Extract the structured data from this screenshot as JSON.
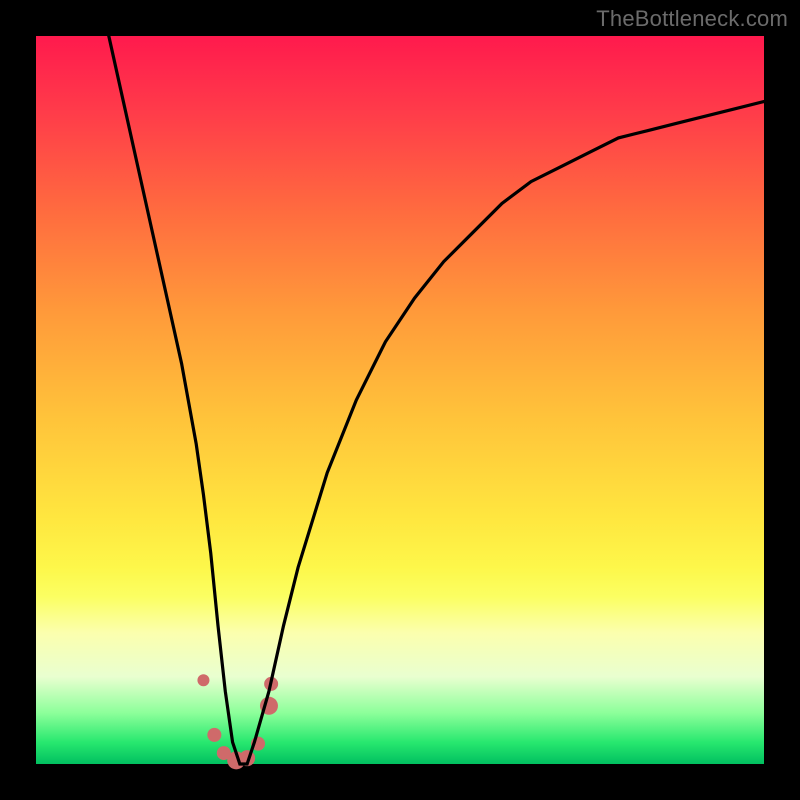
{
  "watermark": "TheBottleneck.com",
  "chart_data": {
    "type": "line",
    "title": "",
    "xlabel": "",
    "ylabel": "",
    "xlim": [
      0,
      100
    ],
    "ylim": [
      0,
      100
    ],
    "grid": false,
    "legend": false,
    "curve": {
      "name": "bottleneck-curve",
      "color": "#000000",
      "x": [
        10,
        12,
        14,
        16,
        18,
        20,
        22,
        23,
        24,
        25,
        26,
        27,
        28,
        29,
        30,
        32,
        34,
        36,
        40,
        44,
        48,
        52,
        56,
        60,
        64,
        68,
        72,
        76,
        80,
        84,
        88,
        92,
        96,
        100
      ],
      "y": [
        100,
        91,
        82,
        73,
        64,
        55,
        44,
        37,
        29,
        19,
        10,
        3,
        0,
        0,
        3,
        10,
        19,
        27,
        40,
        50,
        58,
        64,
        69,
        73,
        77,
        80,
        82,
        84,
        86,
        87,
        88,
        89,
        90,
        91
      ]
    },
    "markers": {
      "name": "highlight-points",
      "color": "#cf6a6a",
      "points": [
        {
          "x": 23.0,
          "y": 11.5,
          "r": 6
        },
        {
          "x": 24.5,
          "y": 4.0,
          "r": 7
        },
        {
          "x": 25.8,
          "y": 1.5,
          "r": 7
        },
        {
          "x": 27.5,
          "y": 0.5,
          "r": 9
        },
        {
          "x": 29.0,
          "y": 0.8,
          "r": 8
        },
        {
          "x": 30.5,
          "y": 2.8,
          "r": 7
        },
        {
          "x": 32.0,
          "y": 8.0,
          "r": 9
        },
        {
          "x": 32.3,
          "y": 11.0,
          "r": 7
        }
      ]
    }
  }
}
